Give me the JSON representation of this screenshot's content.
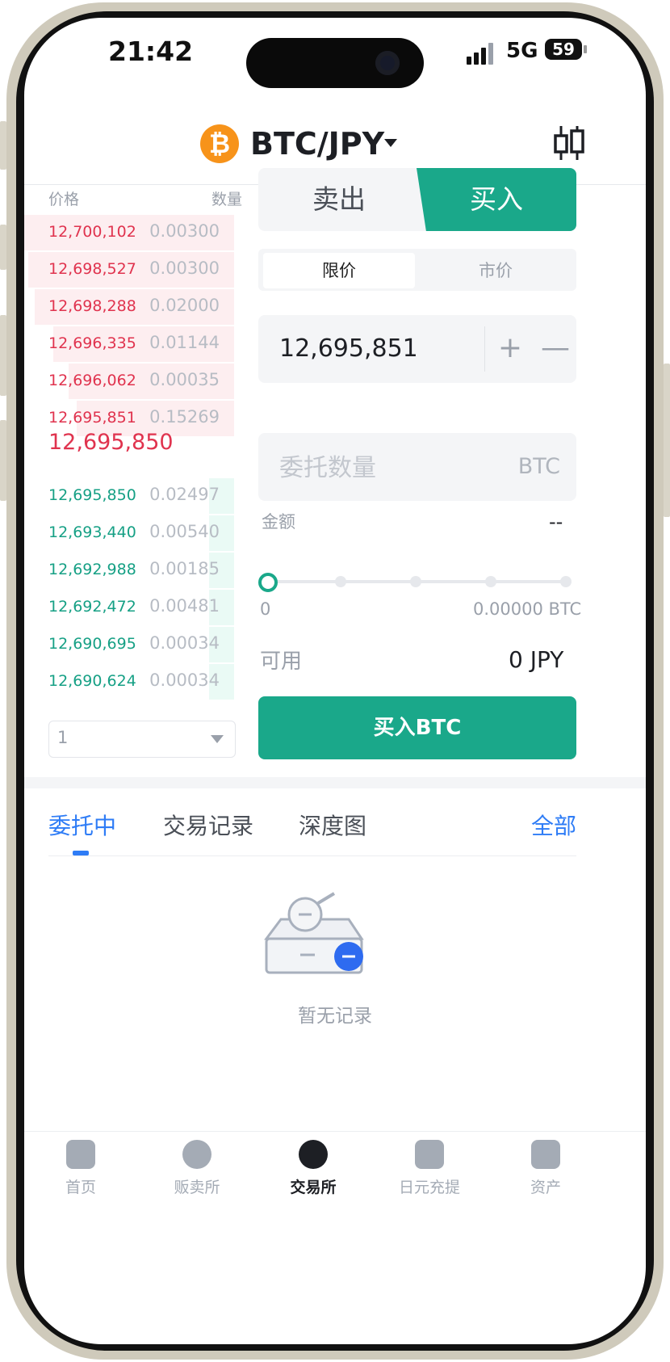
{
  "status": {
    "time": "21:42",
    "network": "5G",
    "battery": "59"
  },
  "header": {
    "pair": "BTC/JPY",
    "coin_symbol": "₿"
  },
  "orderbook": {
    "price_header": "价格",
    "qty_header": "数量",
    "asks": [
      {
        "price": "12,700,102",
        "qty": "0.00300",
        "depth": 1.0
      },
      {
        "price": "12,698,527",
        "qty": "0.00300",
        "depth": 0.98
      },
      {
        "price": "12,698,288",
        "qty": "0.02000",
        "depth": 0.95
      },
      {
        "price": "12,696,335",
        "qty": "0.01144",
        "depth": 0.86
      },
      {
        "price": "12,696,062",
        "qty": "0.00035",
        "depth": 0.79
      },
      {
        "price": "12,695,851",
        "qty": "0.15269",
        "depth": 0.75
      }
    ],
    "last_price": "12,695,850",
    "bids": [
      {
        "price": "12,695,850",
        "qty": "0.02497",
        "depth": 0.12
      },
      {
        "price": "12,693,440",
        "qty": "0.00540",
        "depth": 0.12
      },
      {
        "price": "12,692,988",
        "qty": "0.00185",
        "depth": 0.12
      },
      {
        "price": "12,692,472",
        "qty": "0.00481",
        "depth": 0.12
      },
      {
        "price": "12,690,695",
        "qty": "0.00034",
        "depth": 0.12
      },
      {
        "price": "12,690,624",
        "qty": "0.00034",
        "depth": 0.12
      }
    ],
    "depth_select": "1"
  },
  "trade": {
    "sell_tab": "卖出",
    "buy_tab": "买入",
    "limit_tab": "限价",
    "market_tab": "市价",
    "price_value": "12,695,851",
    "plus": "+",
    "minus": "—",
    "qty_placeholder": "委托数量",
    "qty_unit": "BTC",
    "amount_label": "金额",
    "amount_value": "--",
    "slider_min": "0",
    "slider_max": "0.00000 BTC",
    "slider_level": 0,
    "available_label": "可用",
    "available_value": "0 JPY",
    "buy_button": "买入BTC"
  },
  "orders": {
    "tabs": [
      "委托中",
      "交易记录",
      "深度图"
    ],
    "all": "全部",
    "empty_text": "暂无记录"
  },
  "tabbar": [
    {
      "label": "首页",
      "icon": "home-chart-icon"
    },
    {
      "label": "贩卖所",
      "icon": "exchange-wave-icon"
    },
    {
      "label": "交易所",
      "icon": "coin-stack-icon",
      "active": true
    },
    {
      "label": "日元充提",
      "icon": "transfer-icon"
    },
    {
      "label": "资产",
      "icon": "wallet-icon"
    }
  ],
  "colors": {
    "accent": "#1aa88a",
    "ask": "#e0334e",
    "bid": "#16a085",
    "link": "#2e7cf6"
  }
}
